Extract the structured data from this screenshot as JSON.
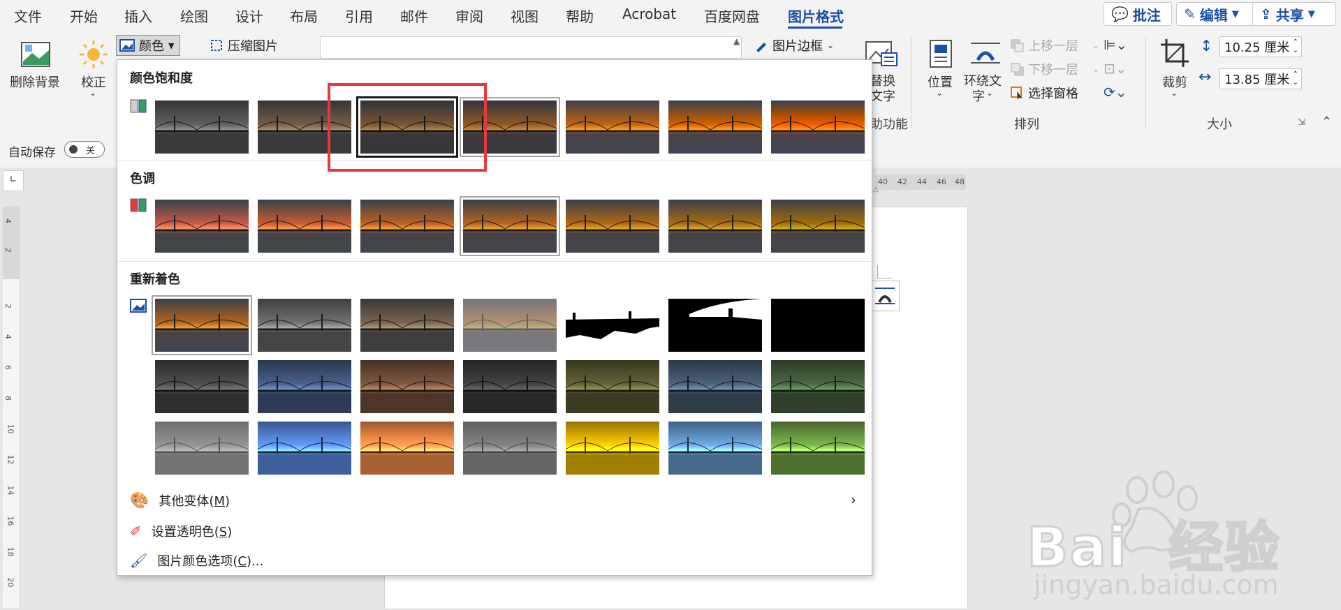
{
  "menubar": {
    "tabs": [
      "文件",
      "开始",
      "插入",
      "绘图",
      "设计",
      "布局",
      "引用",
      "邮件",
      "审阅",
      "视图",
      "帮助",
      "Acrobat",
      "百度网盘",
      "图片格式"
    ],
    "active_tab": "图片格式",
    "comment_label": "批注",
    "edit_label": "编辑",
    "share_label": "共享"
  },
  "ribbon": {
    "remove_bg": "删除背景",
    "correct": "校正",
    "color": "颜色",
    "compress": "压缩图片",
    "picture_border": "图片边框",
    "alt_text_line1": "替换",
    "alt_text_line2": "文字",
    "position": "位置",
    "wrap_line1": "环绕文",
    "wrap_line2": "字",
    "bring_forward": "上移一层",
    "send_backward": "下移一层",
    "selection_pane": "选择窗格",
    "crop": "裁剪",
    "height_value": "10.25 厘米",
    "width_value": "13.85 厘米",
    "group_accessibility": "助功能",
    "group_arrange": "排列",
    "group_size": "大小"
  },
  "autosave": {
    "label": "自动保存",
    "toggle": "关"
  },
  "ruler": {
    "h_ticks": [
      "40",
      "42",
      "44",
      "46",
      "48"
    ],
    "v_ticks": [
      "4",
      "2",
      "2",
      "4",
      "6",
      "8",
      "10",
      "12",
      "14",
      "16",
      "18",
      "20"
    ]
  },
  "dropdown": {
    "saturation_title": "颜色饱和度",
    "tone_title": "色调",
    "recolor_title": "重新着色",
    "more_variations": "其他变体(",
    "more_variations_key": "M",
    "set_transparent": "设置透明色(",
    "set_transparent_key": "S",
    "color_options": "图片颜色选项(",
    "color_options_key": "C",
    "close_paren": ")",
    "color_options_tail": ")..."
  },
  "watermark": {
    "brand": "Bai  经验",
    "url": "jingyan.baidu.com"
  },
  "colors": {
    "accent": "#1c4fa8",
    "highlight_box": "#e8383d"
  }
}
